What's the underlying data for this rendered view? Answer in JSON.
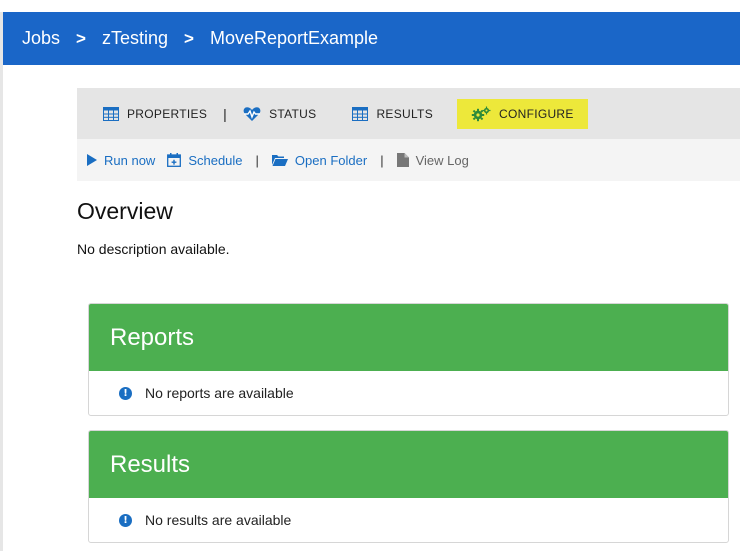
{
  "breadcrumb": {
    "items": [
      "Jobs",
      "zTesting",
      "MoveReportExample"
    ],
    "separator": ">"
  },
  "tabs": [
    {
      "label": "PROPERTIES",
      "icon": "table-icon"
    },
    {
      "label": "STATUS",
      "icon": "heartbeat-icon"
    },
    {
      "label": "RESULTS",
      "icon": "table-icon"
    },
    {
      "label": "CONFIGURE",
      "icon": "gears-icon",
      "active": true
    }
  ],
  "tab_separator": "|",
  "actions": [
    {
      "label": "Run now",
      "icon": "play-icon"
    },
    {
      "label": "Schedule",
      "icon": "calendar-icon"
    },
    {
      "label": "Open Folder",
      "icon": "folder-open-icon"
    },
    {
      "label": "View Log",
      "icon": "file-icon",
      "disabled": true
    }
  ],
  "action_separator": "|",
  "overview": {
    "title": "Overview",
    "description": "No description available."
  },
  "reports_panel": {
    "title": "Reports",
    "message": "No reports are available"
  },
  "results_panel": {
    "title": "Results",
    "message": "No results are available"
  },
  "colors": {
    "header_bg": "#1a66c8",
    "panel_header_bg": "#4caf50",
    "active_tab_bg": "#ede83a",
    "link_blue": "#1a6ec2"
  }
}
